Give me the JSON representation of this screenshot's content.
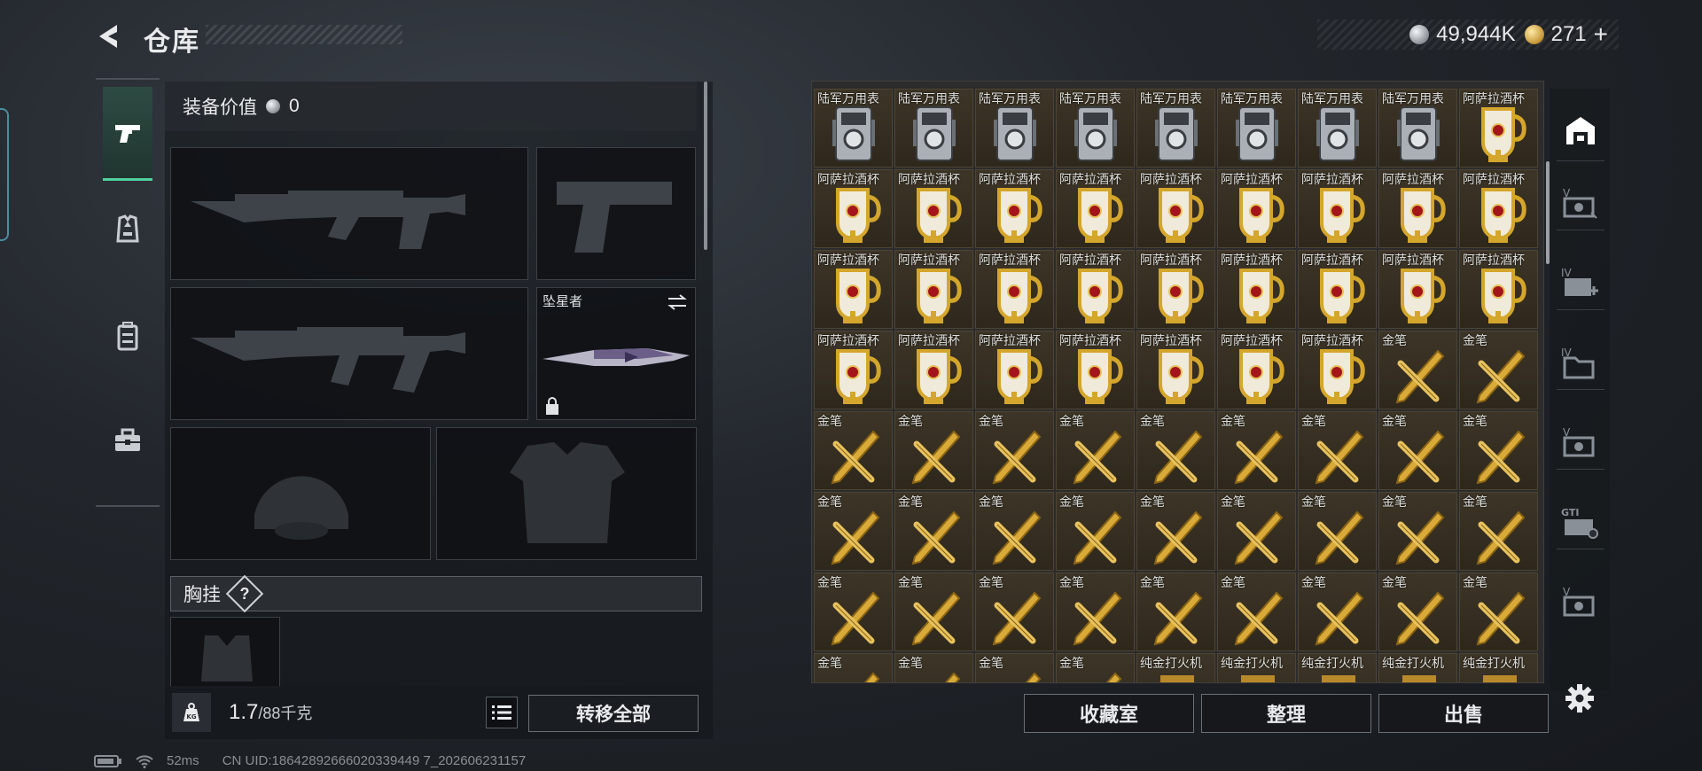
{
  "header": {
    "title": "仓库"
  },
  "currency": {
    "silver": "49,944K",
    "gold": "271",
    "gold_add": "+"
  },
  "loadout": {
    "value_label": "装备价值",
    "value": "0",
    "melee_name": "坠星者",
    "chest_label": "胸挂",
    "help_mark": "?"
  },
  "weight": {
    "current": "1.7",
    "max": "/88千克",
    "icon_text": "KG"
  },
  "buttons": {
    "transfer_all": "转移全部",
    "collection": "收藏室",
    "organize": "整理",
    "sell": "出售"
  },
  "storage": {
    "rows": [
      [
        "陆军万用表",
        "陆军万用表",
        "陆军万用表",
        "陆军万用表",
        "陆军万用表",
        "陆军万用表",
        "陆军万用表",
        "陆军万用表",
        "阿萨拉酒杯"
      ],
      [
        "阿萨拉酒杯",
        "阿萨拉酒杯",
        "阿萨拉酒杯",
        "阿萨拉酒杯",
        "阿萨拉酒杯",
        "阿萨拉酒杯",
        "阿萨拉酒杯",
        "阿萨拉酒杯",
        "阿萨拉酒杯"
      ],
      [
        "阿萨拉酒杯",
        "阿萨拉酒杯",
        "阿萨拉酒杯",
        "阿萨拉酒杯",
        "阿萨拉酒杯",
        "阿萨拉酒杯",
        "阿萨拉酒杯",
        "阿萨拉酒杯",
        "阿萨拉酒杯"
      ],
      [
        "阿萨拉酒杯",
        "阿萨拉酒杯",
        "阿萨拉酒杯",
        "阿萨拉酒杯",
        "阿萨拉酒杯",
        "阿萨拉酒杯",
        "阿萨拉酒杯",
        "金笔",
        "金笔"
      ],
      [
        "金笔",
        "金笔",
        "金笔",
        "金笔",
        "金笔",
        "金笔",
        "金笔",
        "金笔",
        "金笔"
      ],
      [
        "金笔",
        "金笔",
        "金笔",
        "金笔",
        "金笔",
        "金笔",
        "金笔",
        "金笔",
        "金笔"
      ],
      [
        "金笔",
        "金笔",
        "金笔",
        "金笔",
        "金笔",
        "金笔",
        "金笔",
        "金笔",
        "金笔"
      ],
      [
        "金笔",
        "金笔",
        "金笔",
        "金笔",
        "纯金打火机",
        "纯金打火机",
        "纯金打火机",
        "纯金打火机",
        "纯金打火机"
      ]
    ]
  },
  "footer": {
    "ping": "52ms",
    "uid": "CN UID:18642892666020339449 7_202606231157"
  },
  "icons": {
    "back": "back-arrow-icon",
    "pistol": "pistol-icon",
    "armor": "armor-icon",
    "backpack": "backpack-icon",
    "toolbox": "toolbox-icon",
    "settings": "gear-icon"
  }
}
